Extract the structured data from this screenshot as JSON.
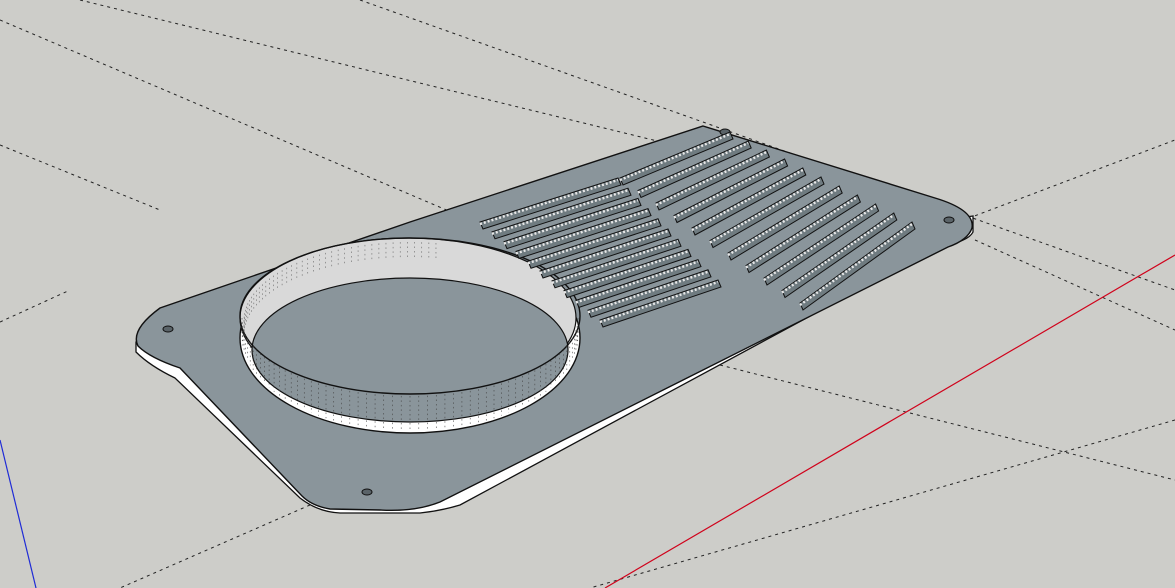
{
  "app": {
    "canvas_background": "#cdcdc9",
    "axis_colors": {
      "red": "#d0021b",
      "blue": "#1f2bd6"
    }
  },
  "model": {
    "object": "vent-plate",
    "plate_top_color": "#8a959b",
    "plate_edge_color": "#ffffff",
    "ring_inner_color": "#ffffff",
    "ring_shade_color": "#d9d9d9",
    "slot_color": "#6f7b80",
    "louver_rows": 11,
    "mounting_holes": 4
  }
}
